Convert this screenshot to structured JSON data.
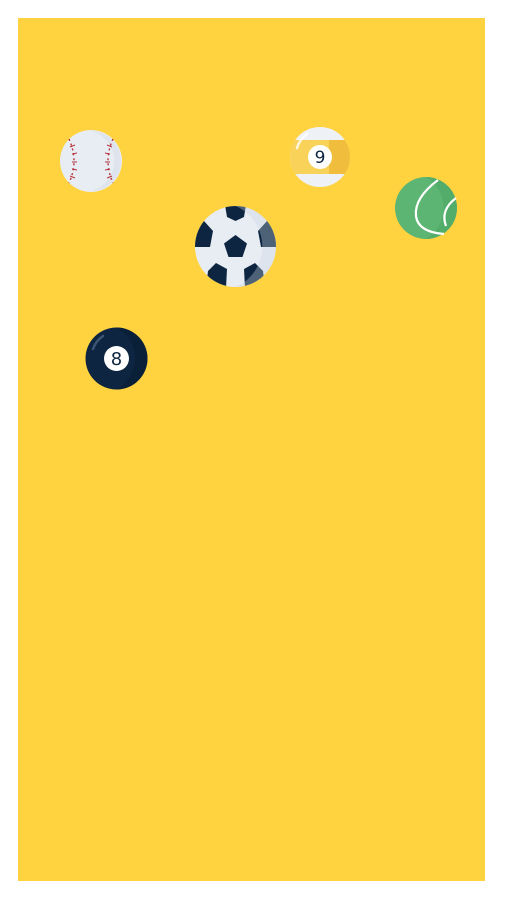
{
  "scene": {
    "background_color": "#FFD23F",
    "page_color": "#FFFFFF"
  },
  "balls": [
    {
      "name": "baseball",
      "icon": "baseball-icon",
      "color": "#E8EDF4",
      "stitch_color": "#B5323B"
    },
    {
      "name": "nine-ball",
      "icon": "pool-ball-9-icon",
      "label": "9",
      "stripe_color": "#F9D25A"
    },
    {
      "name": "tennis-ball",
      "icon": "tennis-ball-icon",
      "color": "#5DB573",
      "seam_color": "#FFFFFF"
    },
    {
      "name": "soccer-ball",
      "icon": "soccer-ball-icon",
      "color": "#E8EDF4",
      "patch_color": "#0D2540"
    },
    {
      "name": "eight-ball",
      "icon": "pool-ball-8-icon",
      "label": "8",
      "color": "#0D2540"
    }
  ]
}
